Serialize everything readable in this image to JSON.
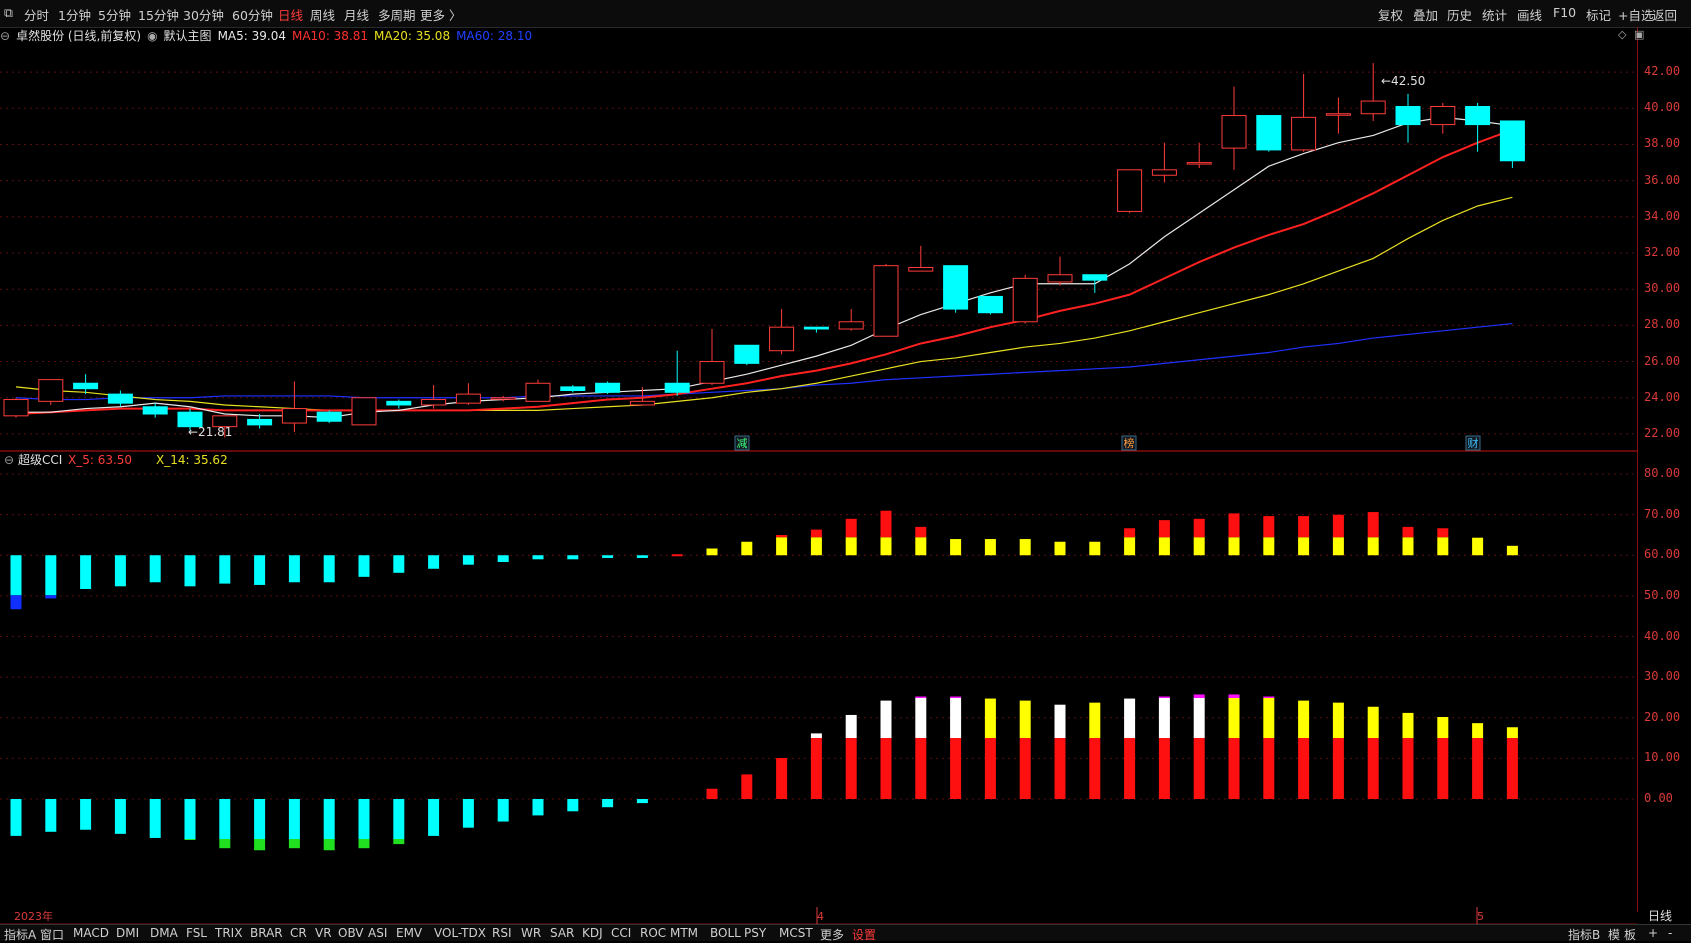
{
  "toolbar": {
    "left_items": [
      "分时",
      "1分钟",
      "5分钟",
      "15分钟",
      "30分钟",
      "60分钟",
      "日线",
      "周线",
      "月线",
      "多周期",
      "更多 〉"
    ],
    "active_item": "日线",
    "right_items": [
      "复权",
      "叠加",
      "历史",
      "统计",
      "画线",
      "F10",
      "标记",
      "+自选",
      "返回"
    ]
  },
  "main_info": {
    "stock": "卓然股份 (日线,前复权)",
    "main_chart_label": "默认主图",
    "ma5": "MA5: 39.04",
    "ma10": "MA10: 38.81",
    "ma20": "MA20: 35.08",
    "ma60": "MA60: 28.10"
  },
  "indicator_info": {
    "name": "超级CCI",
    "x5": "X_5: 63.50",
    "x14": "X_14: 35.62"
  },
  "colors": {
    "up": "#ff3b3b",
    "down": "#00ffff",
    "ma5": "#e8e8e8",
    "ma10": "#ff2020",
    "ma20": "#e8e020",
    "ma60": "#2030ff",
    "axis": "#d93a3a"
  },
  "price_axis": [
    "42.00",
    "40.00",
    "38.00",
    "36.00",
    "34.00",
    "32.00",
    "30.00",
    "28.00",
    "26.00",
    "24.00",
    "22.00"
  ],
  "indicator_axis": [
    "80.00",
    "70.00",
    "60.00",
    "50.00",
    "40.00",
    "30.00",
    "20.00",
    "10.00",
    "0.00"
  ],
  "annotations": {
    "high": "42.50",
    "low": "21.81"
  },
  "event_markers": [
    "减",
    "榜",
    "财"
  ],
  "date_labels": {
    "year": "2023年",
    "m4": "4",
    "m5": "5",
    "period": "日线"
  },
  "bottom_tabs": [
    "指标A",
    "窗口",
    "MACD",
    "DMI",
    "DMA",
    "FSL",
    "TRIX",
    "BRAR",
    "CR",
    "VR",
    "OBV",
    "ASI",
    "EMV",
    "VOL-TDX",
    "RSI",
    "WR",
    "SAR",
    "KDJ",
    "CCI",
    "ROC",
    "MTM",
    "BOLL",
    "PSY",
    "MCST",
    "更多",
    "设置"
  ],
  "bottom_right": [
    "指标B",
    "模",
    "板",
    "+",
    "-"
  ],
  "chart_data": {
    "type": "candlestick",
    "candles": [
      [
        23.0,
        23.9,
        22.9,
        24.0
      ],
      [
        23.8,
        25.0,
        23.6,
        25.0
      ],
      [
        24.8,
        24.5,
        24.2,
        25.3
      ],
      [
        24.2,
        23.7,
        23.5,
        24.4
      ],
      [
        23.5,
        23.1,
        22.9,
        23.7
      ],
      [
        23.2,
        22.4,
        22.2,
        23.4
      ],
      [
        22.4,
        23.0,
        21.8,
        23.0
      ],
      [
        22.8,
        22.5,
        22.3,
        23.1
      ],
      [
        22.6,
        23.4,
        22.1,
        24.9
      ],
      [
        23.2,
        22.7,
        22.6,
        23.3
      ],
      [
        22.5,
        24.0,
        22.5,
        24.0
      ],
      [
        23.8,
        23.6,
        23.4,
        23.9
      ],
      [
        23.6,
        23.9,
        23.4,
        24.7
      ],
      [
        23.7,
        24.2,
        23.6,
        24.8
      ],
      [
        24.0,
        24.0,
        23.8,
        24.1
      ],
      [
        23.8,
        24.8,
        23.8,
        25.0
      ],
      [
        24.6,
        24.4,
        24.3,
        24.7
      ],
      [
        24.8,
        24.3,
        24.2,
        24.9
      ],
      [
        23.6,
        23.8,
        23.6,
        24.6
      ],
      [
        24.8,
        24.3,
        24.1,
        26.6
      ],
      [
        24.8,
        26.0,
        24.7,
        27.8
      ],
      [
        26.9,
        25.9,
        25.8,
        26.9
      ],
      [
        26.6,
        27.9,
        26.4,
        28.9
      ],
      [
        27.9,
        27.8,
        27.6,
        27.9
      ],
      [
        27.8,
        28.2,
        27.7,
        28.9
      ],
      [
        27.4,
        31.3,
        27.4,
        31.4
      ],
      [
        31.0,
        31.2,
        31.0,
        32.4
      ],
      [
        31.3,
        28.9,
        28.7,
        31.3
      ],
      [
        29.6,
        28.7,
        28.6,
        29.6
      ],
      [
        28.2,
        30.6,
        28.1,
        30.8
      ],
      [
        30.4,
        30.8,
        30.2,
        31.8
      ],
      [
        30.8,
        30.5,
        29.8,
        30.8
      ],
      [
        34.3,
        36.6,
        34.2,
        36.6
      ],
      [
        36.3,
        36.6,
        35.9,
        38.1
      ],
      [
        37.0,
        37.0,
        36.7,
        38.1
      ],
      [
        37.8,
        39.6,
        36.6,
        41.2
      ],
      [
        39.6,
        37.7,
        37.6,
        39.6
      ],
      [
        37.7,
        39.5,
        37.6,
        41.9
      ],
      [
        39.7,
        39.7,
        38.6,
        40.6
      ],
      [
        39.7,
        40.4,
        39.3,
        42.5
      ],
      [
        40.1,
        39.1,
        38.1,
        40.8
      ],
      [
        39.1,
        40.1,
        38.6,
        40.3
      ],
      [
        40.1,
        39.1,
        37.6,
        40.3
      ],
      [
        39.3,
        37.1,
        36.7,
        39.3
      ]
    ],
    "ma5": [
      23.2,
      23.2,
      23.4,
      23.5,
      23.7,
      23.5,
      23.1,
      23.0,
      23.0,
      22.9,
      23.2,
      23.3,
      23.6,
      23.8,
      23.9,
      24.0,
      24.2,
      24.3,
      24.4,
      24.5,
      24.9,
      25.3,
      25.8,
      26.3,
      26.9,
      27.8,
      28.6,
      29.2,
      29.8,
      30.3,
      30.3,
      30.3,
      31.4,
      32.9,
      34.2,
      35.5,
      36.8,
      37.5,
      38.1,
      38.5,
      39.2,
      39.5,
      39.3,
      39.04
    ],
    "ma10": [
      23.1,
      23.2,
      23.3,
      23.4,
      23.4,
      23.4,
      23.3,
      23.3,
      23.3,
      23.3,
      23.3,
      23.3,
      23.3,
      23.3,
      23.4,
      23.5,
      23.7,
      23.9,
      24.0,
      24.2,
      24.5,
      24.8,
      25.2,
      25.5,
      25.9,
      26.4,
      27.0,
      27.4,
      27.9,
      28.3,
      28.8,
      29.2,
      29.7,
      30.6,
      31.5,
      32.3,
      33.0,
      33.6,
      34.4,
      35.3,
      36.3,
      37.3,
      38.1,
      38.81
    ],
    "ma20": [
      24.6,
      24.4,
      24.3,
      24.1,
      23.9,
      23.8,
      23.6,
      23.5,
      23.4,
      23.3,
      23.3,
      23.3,
      23.3,
      23.3,
      23.3,
      23.3,
      23.4,
      23.5,
      23.6,
      23.8,
      24.0,
      24.3,
      24.5,
      24.8,
      25.2,
      25.6,
      26.0,
      26.2,
      26.5,
      26.8,
      27.0,
      27.3,
      27.7,
      28.2,
      28.7,
      29.2,
      29.7,
      30.3,
      31.0,
      31.7,
      32.8,
      33.8,
      34.6,
      35.08
    ],
    "ma60": [
      24.0,
      23.9,
      23.9,
      24.0,
      24.0,
      24.0,
      24.1,
      24.1,
      24.1,
      24.1,
      24.0,
      24.0,
      24.0,
      24.0,
      24.0,
      24.1,
      24.1,
      24.1,
      24.1,
      24.2,
      24.3,
      24.4,
      24.5,
      24.7,
      24.8,
      25.0,
      25.1,
      25.2,
      25.3,
      25.4,
      25.5,
      25.6,
      25.7,
      25.9,
      26.1,
      26.3,
      26.5,
      26.8,
      27.0,
      27.3,
      27.5,
      27.7,
      27.9,
      28.1
    ],
    "ylim": [
      21.0,
      43.5
    ],
    "cci_upper": [
      -4,
      -3.2,
      -2.5,
      -2.3,
      -2.0,
      -2.3,
      -2.1,
      -2.2,
      -2.0,
      -2.0,
      -1.6,
      -1.3,
      -1.0,
      -0.7,
      -0.5,
      -0.3,
      -0.3,
      -0.2,
      -0.2,
      0.0,
      0.5,
      1.0,
      1.5,
      1.9,
      2.7,
      3.3,
      2.1,
      1.2,
      1.2,
      1.2,
      1.0,
      1.0,
      2.0,
      2.6,
      2.7,
      3.1,
      2.9,
      2.9,
      3.0,
      3.2,
      2.1,
      2.0,
      1.3,
      0.7
    ],
    "cci_lower": [
      -1.8,
      -1.6,
      -1.5,
      -1.7,
      -1.9,
      -2.0,
      -2.4,
      -2.5,
      -2.4,
      -2.5,
      -2.4,
      -2.2,
      -1.8,
      -1.4,
      -1.1,
      -0.8,
      -0.6,
      -0.4,
      -0.2,
      0.0,
      0.5,
      1.2,
      2.0,
      3.2,
      4.1,
      4.8,
      5.0,
      5.0,
      4.9,
      4.8,
      4.6,
      4.7,
      4.9,
      5.0,
      5.1,
      5.1,
      5.0,
      4.8,
      4.7,
      4.5,
      4.2,
      4.0,
      3.7,
      3.5
    ],
    "x5": 63.5,
    "x14": 35.62
  }
}
